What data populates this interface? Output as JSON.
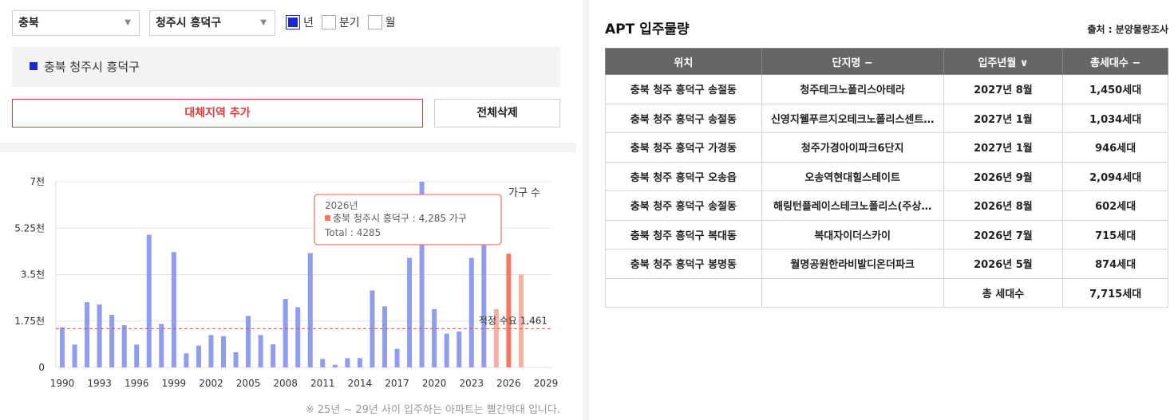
{
  "filters": {
    "province": "충북",
    "district": "청주시 흥덕구",
    "period_options": [
      {
        "label": "년",
        "checked": true
      },
      {
        "label": "분기",
        "checked": false
      },
      {
        "label": "월",
        "checked": false
      }
    ]
  },
  "selected_region": "충북 청주시 흥덕구",
  "buttons": {
    "add_alt_region": "대체지역 추가",
    "clear_all": "전체삭제"
  },
  "note": "※ 25년 ~ 29년 사이 입주하는 아파트는 빨간막대 입니다.",
  "chart_data": {
    "type": "bar",
    "unit_label": "가구 수",
    "y_ticks": [
      "0",
      "1.75천",
      "3.5천",
      "5.25천",
      "7천"
    ],
    "ylim": [
      0,
      7000
    ],
    "x_ticks": [
      1990,
      1993,
      1996,
      1999,
      2002,
      2005,
      2008,
      2011,
      2014,
      2017,
      2020,
      2023,
      2026,
      2029
    ],
    "xlim": [
      1990,
      2029
    ],
    "years": [
      1990,
      1991,
      1992,
      1993,
      1994,
      1995,
      1996,
      1997,
      1998,
      1999,
      2000,
      2001,
      2002,
      2003,
      2004,
      2005,
      2006,
      2007,
      2008,
      2009,
      2010,
      2011,
      2012,
      2013,
      2014,
      2015,
      2016,
      2017,
      2018,
      2019,
      2020,
      2021,
      2022,
      2023,
      2024,
      2025,
      2026,
      2027
    ],
    "values": [
      1510,
      860,
      2460,
      2370,
      1980,
      1590,
      860,
      5000,
      1640,
      4350,
      530,
      820,
      1220,
      1180,
      570,
      1940,
      1220,
      870,
      2580,
      2270,
      4310,
      320,
      100,
      350,
      350,
      2900,
      2300,
      700,
      4130,
      7000,
      2200,
      1270,
      1350,
      4130,
      6250,
      2200,
      4285,
      3500
    ],
    "highlight_from_year": 2025,
    "threshold": {
      "label": "적정 수요",
      "value_label": "1,461",
      "value": 1461
    },
    "tooltip": {
      "title": "2026년",
      "series_line": "충북 청주시 흥덕구 : 4,285 가구",
      "total_line": "Total : 4285"
    },
    "colors": {
      "bar": "#8f9cf0",
      "highlight": "#f37a5f",
      "highlight_light": "#f7b0a0",
      "threshold": "#e05050",
      "grid": "#e6e6e6"
    }
  },
  "apt": {
    "title": "APT 입주물량",
    "source": "출처 : 분양물량조사",
    "headers": [
      "위치",
      "단지명 −",
      "입주년월 ∨",
      "총세대수 −"
    ],
    "rows": [
      [
        "충북 청주 흥덕구 송절동",
        "청주테크노폴리스아테라",
        "2027년 8월",
        "1,450세대"
      ],
      [
        "충북 청주 흥덕구 송절동",
        "신영지웰푸르지오테크노폴리스센트…",
        "2027년 1월",
        "1,034세대"
      ],
      [
        "충북 청주 흥덕구 가경동",
        "청주가경아이파크6단지",
        "2027년 1월",
        "946세대"
      ],
      [
        "충북 청주 흥덕구 오송읍",
        "오송역현대힐스테이트",
        "2026년 9월",
        "2,094세대"
      ],
      [
        "충북 청주 흥덕구 송절동",
        "해링턴플레이스테크노폴리스(주상…",
        "2026년 8월",
        "602세대"
      ],
      [
        "충북 청주 흥덕구 복대동",
        "복대자이더스카이",
        "2026년 7월",
        "715세대"
      ],
      [
        "충북 청주 흥덕구 봉명동",
        "월명공원한라비발디온더파크",
        "2026년 5월",
        "874세대"
      ]
    ],
    "total_label": "총 세대수",
    "total_value": "7,715세대"
  }
}
